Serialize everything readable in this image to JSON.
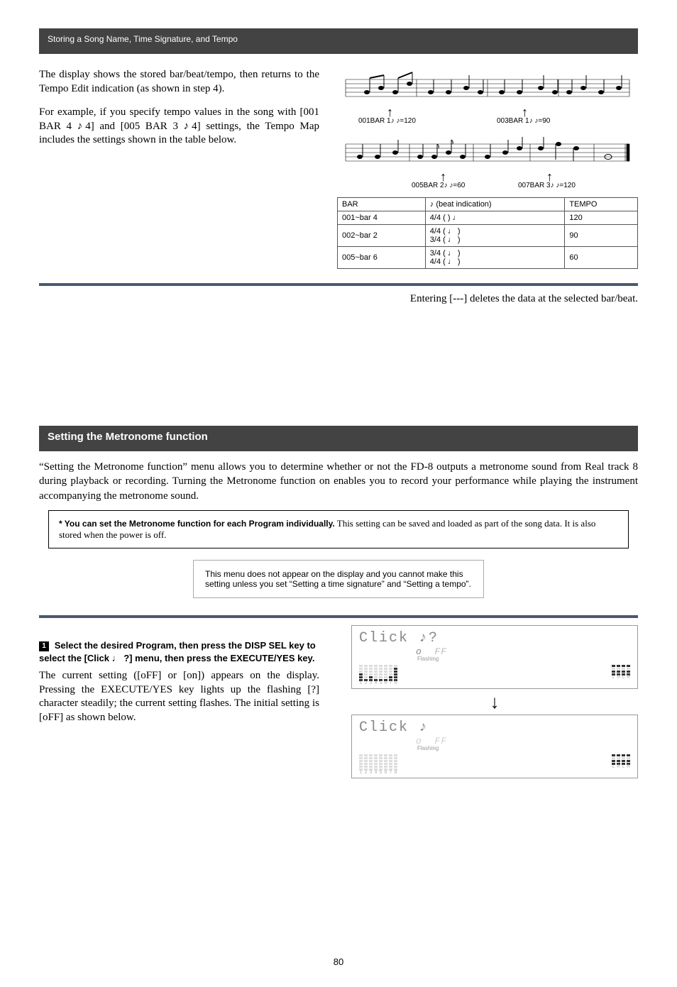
{
  "header": {
    "breadcrumb": "Storing a Song Name, Time Signature, and Tempo"
  },
  "section1": {
    "p1": "The display shows the stored bar/beat/tempo, then returns to the Tempo Edit indication (as shown in step 4).",
    "p2": "For example, if you specify tempo values in the song with [001 BAR 4 ♪4] and [005 BAR 3 ♪4] settings, the Tempo Map includes the settings shown in the table below."
  },
  "staff1": {
    "arrow1": {
      "pos": "70px",
      "label": "001BAR   1♪    ♪=120"
    },
    "arrow2": {
      "pos": "260px",
      "label": "003BAR   1♪    ♪=90"
    }
  },
  "staff2": {
    "arrow1": {
      "pos": "145px",
      "label": "005BAR   2♪    ♪=60"
    },
    "arrow2": {
      "pos": "295px",
      "label": "007BAR   3♪    ♪=120"
    }
  },
  "mapTable": {
    "headers": [
      "BAR",
      "♪ (beat indication)",
      "TEMPO"
    ],
    "rows": [
      {
        "bar": "001~bar 4",
        "beat": "4/4 (    )",
        "tempo": "120"
      },
      {
        "bar": "002~bar 2",
        "beat": "4/4 (    )\n3/4 (    )",
        "tempo": "90"
      },
      {
        "bar": "005~bar 6",
        "beat": "3/4 (    )\n4/4 (    )",
        "tempo": "60"
      }
    ]
  },
  "noteLine": "Entering [---] deletes the data at the selected bar/beat.",
  "sectionBar": "Setting the Metronome function",
  "bodyText": "“Setting the Metronome function” menu allows you to determine whether or not the FD-8 outputs a metronome sound from Real track 8 during playback or recording.  Turning the Metronome function on enables you to record your performance while playing the instrument accompanying the metronome sound.",
  "memo": {
    "lead": "* You can set the Metronome function for each Program individually.",
    "text": " This setting can be saved and loaded as part of the song data.  It is also stored when the power is off."
  },
  "lcdDesc": {
    "text": "This menu does not appear on the display and you cannot make this setting unless you set “Setting a time signature” and “Setting a tempo”."
  },
  "step1": {
    "head": "Select the desired Program, then press the DISP SEL key to select the [Click    ?] menu, then press the EXECUTE/YES key.",
    "body": "The current setting ([oFF] or [on]) appears on the display. Pressing the EXECUTE/YES key lights up the flashing [?] character steadily; the current setting flashes.  The initial setting is [oFF] as shown below."
  },
  "lcd": {
    "line1a": "Click ♪?",
    "line2a": "o FF",
    "flashLabel": "Flashing",
    "line1b": "Click ♪",
    "line2b": "o FF"
  },
  "pageNum": "80"
}
